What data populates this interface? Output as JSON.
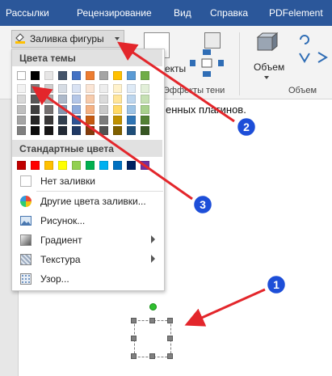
{
  "ribbon": {
    "tabs": [
      "Рассылки",
      "Рецензирование",
      "Вид",
      "Справка",
      "PDFelement"
    ],
    "fill_button_label": "Заливка фигуры",
    "effects_partial_label": "екты",
    "shadow_effects_label": "Эффекты тени",
    "volume_button_label": "Объем",
    "volume_group_label": "Объем"
  },
  "document": {
    "partial_text": "енных плагинов."
  },
  "dropdown": {
    "theme_colors_header": "Цвета темы",
    "standard_colors_header": "Стандартные цвета",
    "no_fill_label": "Нет заливки",
    "more_colors_label": "Другие цвета заливки...",
    "picture_label": "Рисунок...",
    "gradient_label": "Градиент",
    "texture_label": "Текстура",
    "pattern_label": "Узор...",
    "theme_colors": [
      [
        "#FFFFFF",
        "#000000",
        "#E7E6E6",
        "#44546A",
        "#4472C4",
        "#ED7D31",
        "#A5A5A5",
        "#FFC000",
        "#5B9BD5",
        "#70AD47"
      ],
      [
        "#F2F2F2",
        "#7F7F7F",
        "#D0CECE",
        "#D6DCE4",
        "#D9E2F3",
        "#FBE5D5",
        "#EDEDED",
        "#FFF2CC",
        "#DEEAF6",
        "#E2EFD9"
      ],
      [
        "#D8D8D8",
        "#595959",
        "#AEABAB",
        "#ADB9CA",
        "#B4C6E7",
        "#F7CBAC",
        "#DBDBDB",
        "#FFE599",
        "#BDD6EE",
        "#C5E0B3"
      ],
      [
        "#BFBFBF",
        "#3F3F3F",
        "#757070",
        "#8496B0",
        "#8EAADB",
        "#F4B183",
        "#C9C9C9",
        "#FFD966",
        "#9CC3E5",
        "#A8D08D"
      ],
      [
        "#A5A5A5",
        "#262626",
        "#3A3838",
        "#323F4F",
        "#2F5496",
        "#C55A11",
        "#7B7B7B",
        "#BF9000",
        "#2E75B5",
        "#538135"
      ],
      [
        "#7F7F7F",
        "#0C0C0C",
        "#171616",
        "#222A35",
        "#1F3864",
        "#833C0B",
        "#525252",
        "#7F6000",
        "#1E4E79",
        "#375623"
      ]
    ],
    "standard_colors": [
      "#C00000",
      "#FF0000",
      "#FFC000",
      "#FFFF00",
      "#92D050",
      "#00B050",
      "#00B0F0",
      "#0070C0",
      "#002060",
      "#7030A0"
    ]
  },
  "callouts": [
    "1",
    "2",
    "3"
  ],
  "colors": {
    "ribbon_blue": "#2b579a",
    "arrow_red": "#e3262b",
    "callout_blue": "#1d4ed8"
  }
}
